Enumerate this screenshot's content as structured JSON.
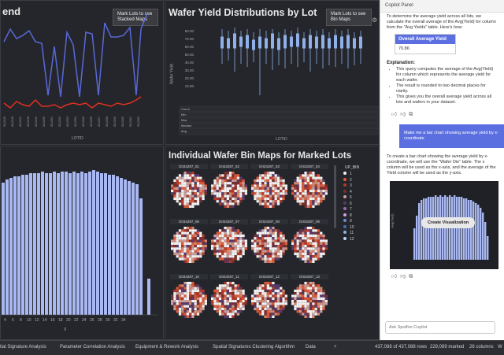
{
  "trend_panel": {
    "title": "end",
    "tooltip": "Mark Lots to see Stacked Maps",
    "xlabel": "LOTID"
  },
  "yield_panel": {
    "title": "Wafer Yield Distributions by Lot",
    "tooltip": "Mark Lots to see Bin Maps",
    "ylabel": "Wafer Yield",
    "xlabel": "LOTID",
    "yticks": [
      "80.00",
      "70.00",
      "60.00",
      "50.00",
      "40.00",
      "30.00",
      "20.00",
      "10.00"
    ],
    "table_rows": [
      "Count",
      "Min",
      "Max",
      "Median",
      "Avg"
    ]
  },
  "bar_panel": {
    "xticks": [
      "4",
      "6",
      "8",
      "10",
      "12",
      "14",
      "16",
      "18",
      "20",
      "22",
      "24",
      "26",
      "28",
      "30",
      "32",
      "34"
    ],
    "xlabel": "X"
  },
  "binmap_panel": {
    "title": "Individual Wafer Bin Maps for Marked Lots",
    "wafers": [
      "IDI34287_01",
      "IDI34287_02",
      "IDI34287_03",
      "IDI34287_04",
      "IDI34287_06",
      "IDI34287_07",
      "IDI34287_08",
      "IDI34287_09",
      "IDI34287_10",
      "IDI34287_11",
      "IDI34287_12",
      "IDI34287_13"
    ],
    "legend_title": "UP_BIN",
    "legend_items": [
      {
        "label": "1",
        "color": "#f0f0f0"
      },
      {
        "label": "2",
        "color": "#e05a3a"
      },
      {
        "label": "3",
        "color": "#b23a2a"
      },
      {
        "label": "4",
        "color": "#7a2f2f"
      },
      {
        "label": "5",
        "color": "#c9a0a0"
      },
      {
        "label": "6",
        "color": "#5a3a6a"
      },
      {
        "label": "7",
        "color": "#9a6ab0"
      },
      {
        "label": "8",
        "color": "#d4a0d8"
      },
      {
        "label": "9",
        "color": "#6a8ad0"
      },
      {
        "label": "10",
        "color": "#4a6ab0"
      },
      {
        "label": "11",
        "color": "#8ab0e0"
      },
      {
        "label": "12",
        "color": "#c0d8f0"
      }
    ]
  },
  "copilot": {
    "header": "Copilot Panel",
    "intro": "To determine the average yield across all lots, we calculate the overall average of the Avg(Yield) for column from the \"Avg Yields\" table. Here's how:",
    "card_title": "Overall Average Yield",
    "card_value": "70.86",
    "explanation_title": "Explanation:",
    "bullets": [
      "This query computes the average of the Avg(Yield) for column which represents the average yield for each wafer.",
      "The result is rounded to two decimal places for clarity.",
      "This gives you the overall average yield across all lots and wafers in your dataset."
    ],
    "user_message": "Make me a bar chart showing average yield by x-coordinate",
    "reply": "To create a bar chart showing the average yield by x-coordinate, we will use the \"Wafer Die\" table. The x column will be used as the x-axis, and the average of the Yield column will be used as the y-axis.",
    "chart_ylabel": "Avg(Yield)",
    "create_button": "Create Visualization",
    "input_placeholder": "Ask Spotfire Copilot"
  },
  "tabs": [
    "tial Signature Analysis",
    "Parameter Correlation Analysis",
    "Equipment & Rework Analysis",
    "Spatial Signatures Clustering Algorithm",
    "Data"
  ],
  "status": {
    "rows": "437,088 of 437,088 rows",
    "marked": "229,089 marked",
    "columns": "26 columns",
    "tail": "W"
  },
  "colors": {
    "accent": "#5b6fe0",
    "bar": "#a9b8f2",
    "line": "#5868d8",
    "red": "#e03020"
  }
}
